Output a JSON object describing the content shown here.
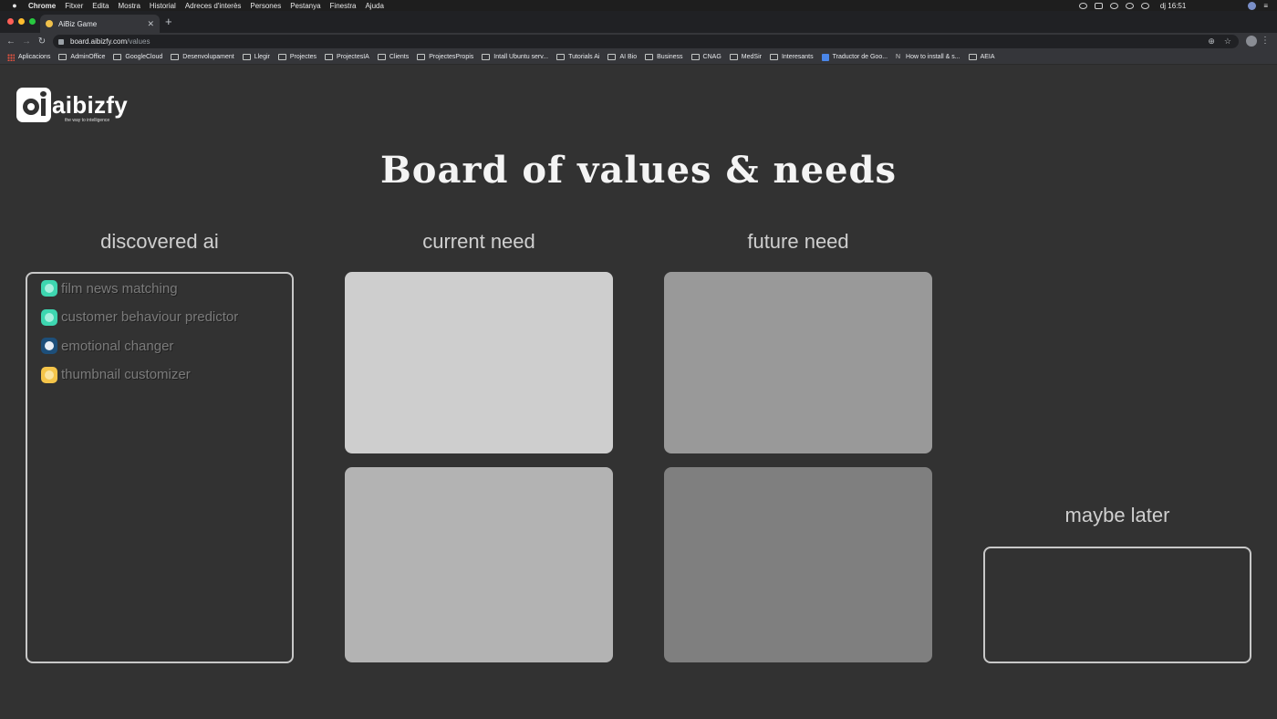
{
  "menubar": {
    "app": "Chrome",
    "items": [
      "Fitxer",
      "Edita",
      "Mostra",
      "Historial",
      "Adreces d'interès",
      "Persones",
      "Pestanya",
      "Finestra",
      "Ajuda"
    ],
    "clock": "dj 16:51"
  },
  "browser": {
    "tab_title": "AiBiz Game",
    "url_host": "board.aibizfy.com",
    "url_path": "/values",
    "traffic_colors": [
      "#ff5f57",
      "#febc2e",
      "#28c840"
    ]
  },
  "bookmarks": {
    "apps_label": "Aplicacions",
    "items": [
      {
        "label": "AdminOffice",
        "icon": "folder-icon"
      },
      {
        "label": "GoogleCloud",
        "icon": "folder-icon"
      },
      {
        "label": "Desenvolupament",
        "icon": "folder-icon"
      },
      {
        "label": "Llegir",
        "icon": "folder-icon"
      },
      {
        "label": "Projectes",
        "icon": "folder-icon"
      },
      {
        "label": "ProjectesIA",
        "icon": "folder-icon"
      },
      {
        "label": "Clients",
        "icon": "folder-icon"
      },
      {
        "label": "ProjectesPropis",
        "icon": "folder-icon"
      },
      {
        "label": "Intall Ubuntu serv...",
        "icon": "folder-icon"
      },
      {
        "label": "Tutorials Ai",
        "icon": "folder-icon"
      },
      {
        "label": "AI Bio",
        "icon": "folder-icon"
      },
      {
        "label": "Business",
        "icon": "folder-icon"
      },
      {
        "label": "CNAG",
        "icon": "folder-icon"
      },
      {
        "label": "MedSir",
        "icon": "folder-icon"
      },
      {
        "label": "Interesants",
        "icon": "folder-icon"
      },
      {
        "label": "Traductor de Goo...",
        "icon": "google-translate-icon"
      },
      {
        "label": "How to install & s...",
        "icon": "n-logo-icon"
      },
      {
        "label": "AEIA",
        "icon": "folder-icon"
      }
    ]
  },
  "page": {
    "logo_text": "aibizfy",
    "logo_tagline": "the way to intelligence",
    "title": "Board of values & needs",
    "columns": {
      "discovered": "discovered ai",
      "current": "current need",
      "future": "future need",
      "maybe": "maybe later"
    },
    "discovered_items": [
      {
        "label": "film news matching",
        "icon_bg": "#3dd6b0",
        "icon_fg": "#a8eede",
        "icon": "hexagon-icon"
      },
      {
        "label": "customer behaviour predictor",
        "icon_bg": "#3dd6b0",
        "icon_fg": "#a8eede",
        "icon": "hexagon-icon"
      },
      {
        "label": "emotional changer",
        "icon_bg": "#1d4f7a",
        "icon_fg": "#e8eef5",
        "icon": "emotion-icon"
      },
      {
        "label": "thumbnail customizer",
        "icon_bg": "#f5c54a",
        "icon_fg": "#fae4a0",
        "icon": "thumbnail-icon"
      }
    ],
    "card_colors": {
      "current_1": "#cecece",
      "current_2": "#b3b3b3",
      "future_1": "#999999",
      "future_2": "#7f7f7f"
    }
  }
}
